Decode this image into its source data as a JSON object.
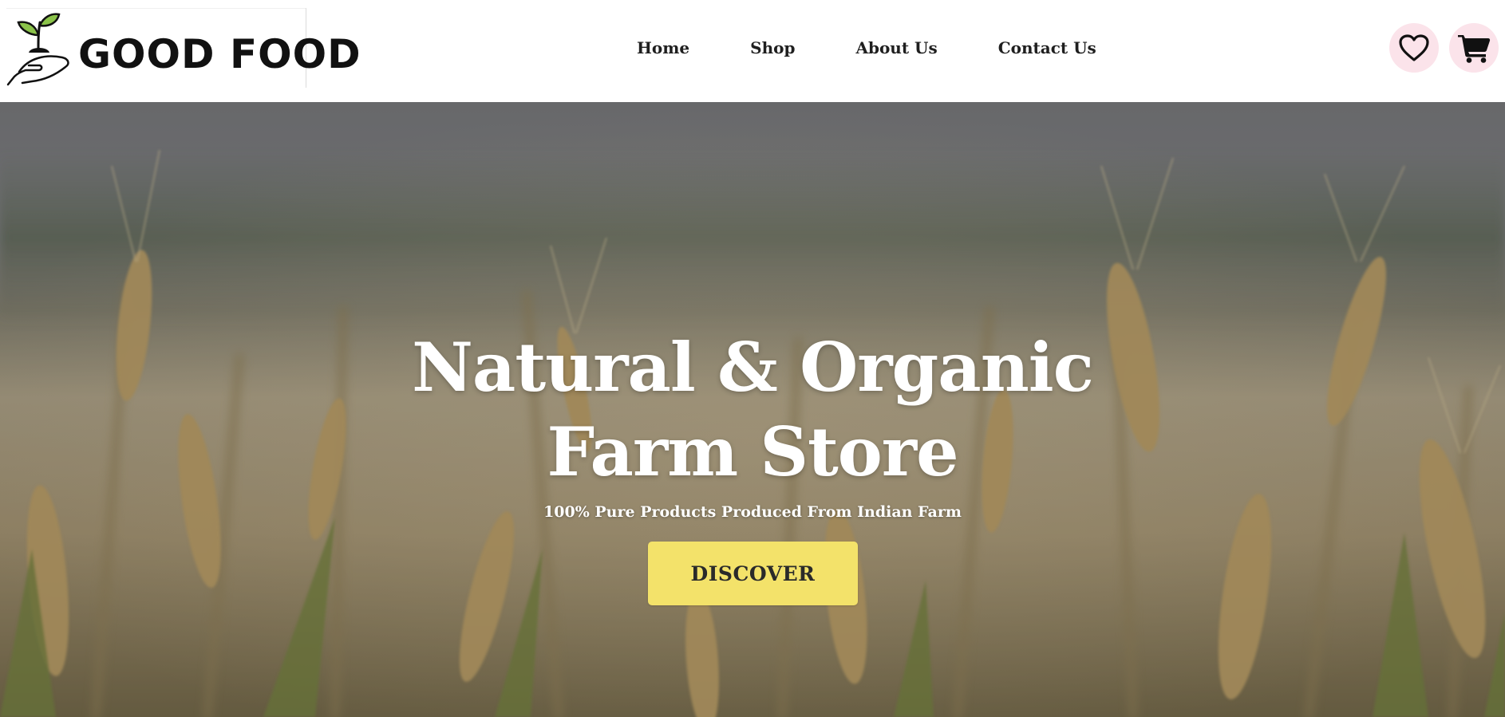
{
  "brand": {
    "name": "GOOD FOOD"
  },
  "nav": {
    "items": [
      {
        "label": "Home"
      },
      {
        "label": "Shop"
      },
      {
        "label": "About Us"
      },
      {
        "label": "Contact Us"
      }
    ]
  },
  "header_actions": {
    "wishlist_icon": "heart-icon",
    "cart_icon": "cart-icon",
    "button_bg": "#fbe3ea"
  },
  "hero": {
    "title_line1": "Natural & Organic",
    "title_line2": "Farm Store",
    "subtitle": "100% Pure Products Produced From Indian Farm",
    "cta_label": "DISCOVER",
    "cta_color": "#f3e26a",
    "background": "wheat-field-photo"
  },
  "colors": {
    "text_dark": "#1f1f1f",
    "leaf_green": "#8bc34a"
  }
}
